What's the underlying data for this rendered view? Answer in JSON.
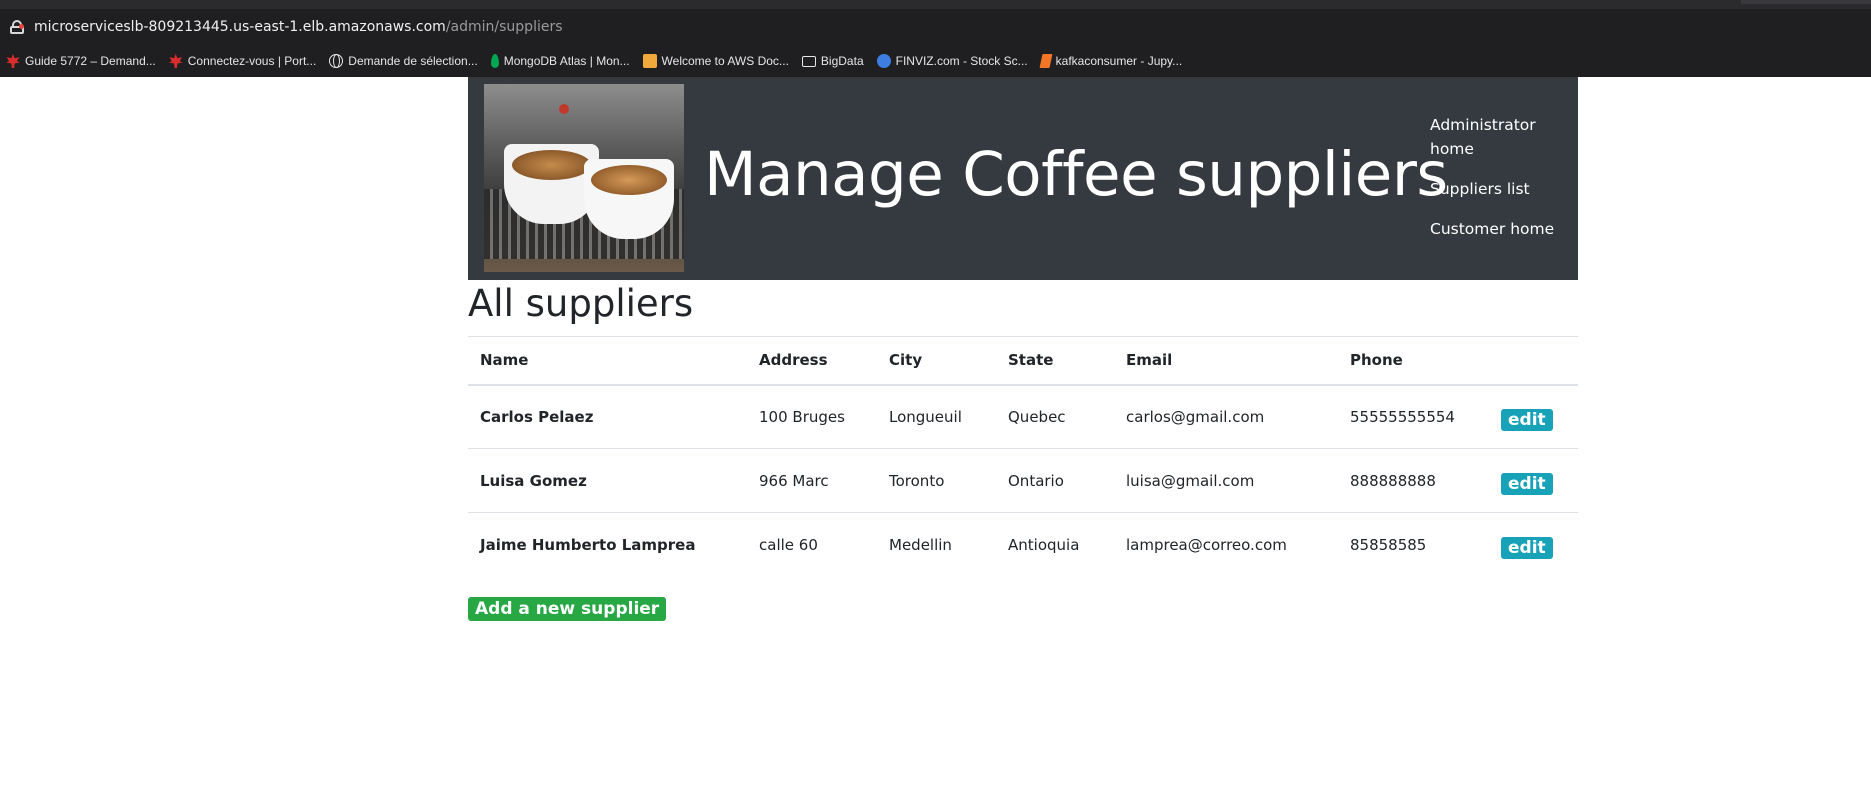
{
  "browser": {
    "url_host": "microserviceslb-809213445.us-east-1.elb.amazonaws.com",
    "url_path": "/admin/suppliers",
    "bookmarks": [
      {
        "label": "Guide 5772 – Demand...",
        "icon": "maple-leaf-icon"
      },
      {
        "label": "Connectez-vous | Port...",
        "icon": "maple-leaf-icon"
      },
      {
        "label": "Demande de sélection...",
        "icon": "globe-icon"
      },
      {
        "label": "MongoDB Atlas | Mon...",
        "icon": "mongodb-leaf-icon"
      },
      {
        "label": "Welcome to AWS Doc...",
        "icon": "aws-cube-icon"
      },
      {
        "label": "BigData",
        "icon": "folder-icon"
      },
      {
        "label": "FINVIZ.com - Stock Sc...",
        "icon": "finviz-icon"
      },
      {
        "label": "kafkaconsumer - Jupy...",
        "icon": "jupyter-icon"
      }
    ]
  },
  "header": {
    "title": "Manage Coffee suppliers",
    "nav": [
      "Administrator home",
      "Suppliers list",
      "Customer home"
    ]
  },
  "main": {
    "heading": "All suppliers",
    "columns": [
      "Name",
      "Address",
      "City",
      "State",
      "Email",
      "Phone"
    ],
    "rows": [
      {
        "name": "Carlos Pelaez",
        "address": "100 Bruges",
        "city": "Longueuil",
        "state": "Quebec",
        "email": "carlos@gmail.com",
        "phone": "55555555554"
      },
      {
        "name": "Luisa Gomez",
        "address": "966 Marc",
        "city": "Toronto",
        "state": "Ontario",
        "email": "luisa@gmail.com",
        "phone": "888888888"
      },
      {
        "name": "Jaime Humberto Lamprea",
        "address": "calle 60",
        "city": "Medellin",
        "state": "Antioquia",
        "email": "lamprea@correo.com",
        "phone": "85858585"
      }
    ],
    "edit_label": "edit",
    "add_label": "Add a new supplier"
  },
  "colors": {
    "banner": "#343a40",
    "edit_button": "#17a2b8",
    "add_button": "#28a745"
  }
}
